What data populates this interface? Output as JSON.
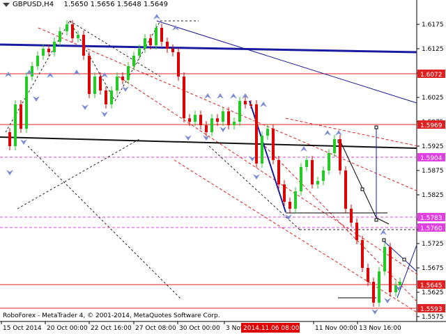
{
  "header": {
    "symbol": "GBPUSD,H4",
    "ohlc": "1.5650 1.5656 1.5648 1.5649"
  },
  "footer": {
    "copyright": "RoboForex - MetaTrader 4, © 2001-2014, MetaQuotes Software Corp."
  },
  "axis": {
    "price_ticks": [
      "1.6175",
      "1.6125",
      "1.6075",
      "1.6025",
      "1.5975",
      "1.5925",
      "1.5875",
      "1.5825",
      "1.5775",
      "1.5725",
      "1.5675",
      "1.5625",
      "1.5575"
    ],
    "time_ticks": [
      "15 Oct 2014",
      "20 Oct 00:00",
      "22 Oct 16:00",
      "27 Oct 08:00",
      "30 Oct 00:00",
      "3 Nov",
      "11 Nov 00:00",
      "13 Nov 16:00"
    ],
    "time_highlight": "2014.11.06 08:00"
  },
  "levels": [
    {
      "label": "1.6072",
      "color": "#e02020"
    },
    {
      "label": "1.5969",
      "color": "#e02020"
    },
    {
      "label": "1.5904",
      "color": "#e040e0"
    },
    {
      "label": "1.5783",
      "color": "#e040e0"
    },
    {
      "label": "1.5760",
      "color": "#e040e0"
    },
    {
      "label": "1.5645",
      "color": "#e02020"
    },
    {
      "label": "1.5593",
      "color": "#e02020"
    }
  ],
  "colors": {
    "bull": "#22cc22",
    "bear": "#e00000",
    "trend": "#1a1aa0",
    "support": "#111111",
    "fractal": "#7a8cd8"
  }
}
